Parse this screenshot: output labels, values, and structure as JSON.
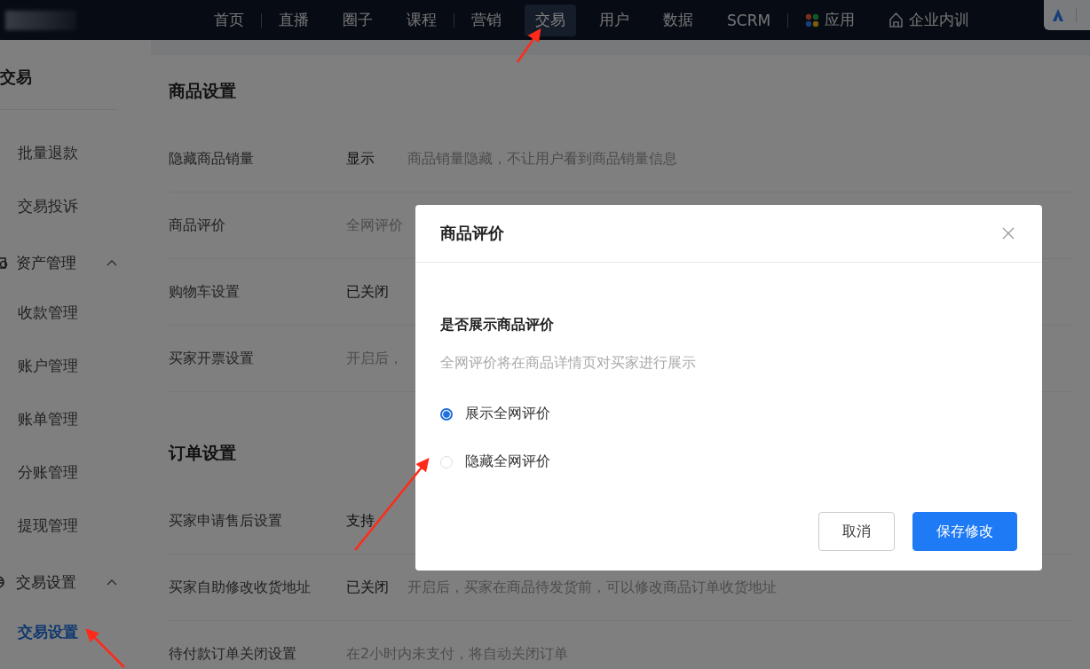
{
  "top_nav": {
    "items": [
      {
        "kind": "text",
        "label": "首页",
        "selected": false,
        "divider": true
      },
      {
        "kind": "text",
        "label": "直播",
        "selected": false,
        "divider": false
      },
      {
        "kind": "text",
        "label": "圈子",
        "selected": false,
        "divider": false
      },
      {
        "kind": "text",
        "label": "课程",
        "selected": false,
        "divider": true
      },
      {
        "kind": "text",
        "label": "营销",
        "selected": false,
        "divider": false
      },
      {
        "kind": "text",
        "label": "交易",
        "selected": true,
        "divider": false
      },
      {
        "kind": "text",
        "label": "用户",
        "selected": false,
        "divider": false
      },
      {
        "kind": "text",
        "label": "数据",
        "selected": false,
        "divider": false
      },
      {
        "kind": "text",
        "label": "SCRM",
        "selected": false,
        "divider": true
      },
      {
        "kind": "icon_text",
        "label": "应用",
        "selected": false,
        "divider": false
      },
      {
        "kind": "icon_text",
        "label": "企业内训",
        "selected": false,
        "divider": false
      }
    ]
  },
  "sidebar": {
    "title": "交易",
    "items": [
      {
        "kind": "item",
        "label": "批量退款",
        "selected": false
      },
      {
        "kind": "item",
        "label": "交易投诉",
        "selected": false
      },
      {
        "kind": "group",
        "label": "资产管理",
        "expanded": true,
        "children": [
          {
            "kind": "item",
            "label": "收款管理",
            "selected": false
          },
          {
            "kind": "item",
            "label": "账户管理",
            "selected": false
          },
          {
            "kind": "item",
            "label": "账单管理",
            "selected": false
          },
          {
            "kind": "item",
            "label": "分账管理",
            "selected": false
          },
          {
            "kind": "item",
            "label": "提现管理",
            "selected": false
          }
        ]
      },
      {
        "kind": "group",
        "label": "交易设置",
        "expanded": true,
        "children": [
          {
            "kind": "item",
            "label": "交易设置",
            "selected": true
          }
        ]
      }
    ]
  },
  "sections": [
    {
      "title": "商品设置",
      "rows": [
        {
          "label": "隐藏商品销量",
          "value": "显示",
          "description": "商品销量隐藏，不让用户看到商品销量信息"
        },
        {
          "label": "商品评价",
          "description": "全网评价"
        },
        {
          "label": "购物车设置",
          "value": "已关闭"
        },
        {
          "label": "买家开票设置",
          "description": "开启后，"
        }
      ]
    },
    {
      "title": "订单设置",
      "rows": [
        {
          "label": "买家申请售后设置",
          "value": "支持"
        },
        {
          "label": "买家自助修改收货地址",
          "value": "已关闭",
          "description": "开启后，买家在商品待发货前，可以修改商品订单收货地址"
        },
        {
          "label": "待付款订单关闭设置",
          "description": "在2小时内未支付，将自动关闭订单"
        }
      ]
    }
  ],
  "dialog": {
    "title": "商品评价",
    "question": "是否展示商品评价",
    "hint": "全网评价将在商品详情页对买家进行展示",
    "options": [
      {
        "label": "展示全网评价",
        "selected": true
      },
      {
        "label": "隐藏全网评价",
        "selected": false
      }
    ],
    "buttons": [
      {
        "kind": "secondary",
        "label": "取消"
      },
      {
        "kind": "primary",
        "label": "保存修改"
      }
    ]
  }
}
